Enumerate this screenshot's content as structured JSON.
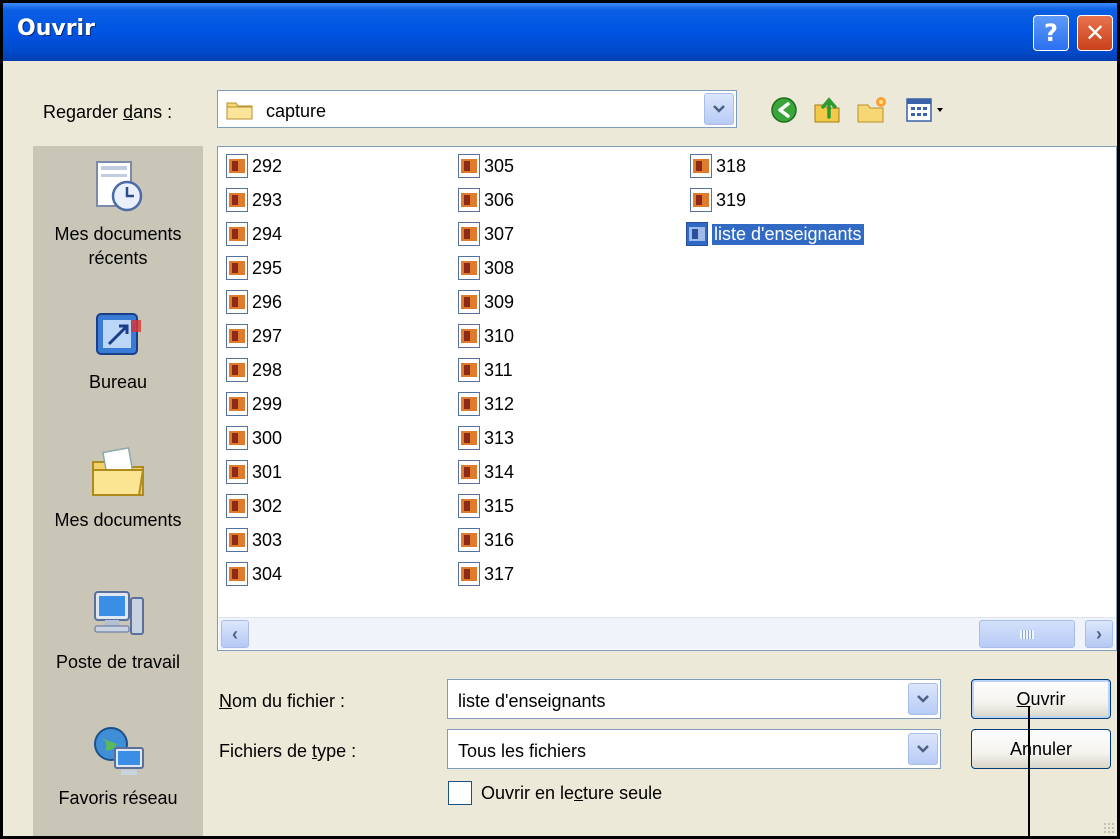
{
  "window": {
    "title": "Ouvrir",
    "help_glyph": "?",
    "close_glyph": "✕"
  },
  "lookin": {
    "label_prefix": "Regarder ",
    "label_underlined": "d",
    "label_suffix": "ans :",
    "value": "capture"
  },
  "toolbar": {
    "icons": [
      "back-icon",
      "up-folder-icon",
      "new-folder-icon",
      "view-menu-icon"
    ]
  },
  "places": [
    {
      "label": "Mes documents récents",
      "icon": "recent-documents-icon"
    },
    {
      "label": "Bureau",
      "icon": "desktop-icon"
    },
    {
      "label": "Mes documents",
      "icon": "my-documents-icon"
    },
    {
      "label": "Poste de travail",
      "icon": "my-computer-icon"
    },
    {
      "label": "Favoris réseau",
      "icon": "network-places-icon"
    }
  ],
  "files": {
    "col1": [
      "292",
      "293",
      "294",
      "295",
      "296",
      "297",
      "298",
      "299",
      "300",
      "301",
      "302",
      "303",
      "304"
    ],
    "col2": [
      "305",
      "306",
      "307",
      "308",
      "309",
      "310",
      "311",
      "312",
      "313",
      "314",
      "315",
      "316",
      "317"
    ],
    "col3": [
      "318",
      "319"
    ],
    "selected": "liste d'enseignants"
  },
  "scrollbar": {
    "left_glyph": "‹",
    "right_glyph": "›"
  },
  "filename": {
    "label_underlined": "N",
    "label_rest": "om du fichier :",
    "value": "liste d'enseignants"
  },
  "filetype": {
    "label_prefix": "Fichiers de ",
    "label_underlined": "t",
    "label_suffix": "ype :",
    "value": "Tous les fichiers"
  },
  "buttons": {
    "open_underlined": "O",
    "open_rest": "uvrir",
    "cancel": "Annuler"
  },
  "readonly": {
    "prefix": "Ouvrir en le",
    "underlined": "c",
    "suffix": "ture seule",
    "checked": false
  },
  "colors": {
    "titlebar": "#0054e3",
    "selection": "#316ac5",
    "dialog_bg": "#ece9d8",
    "places_bg": "#c9c6b8"
  }
}
